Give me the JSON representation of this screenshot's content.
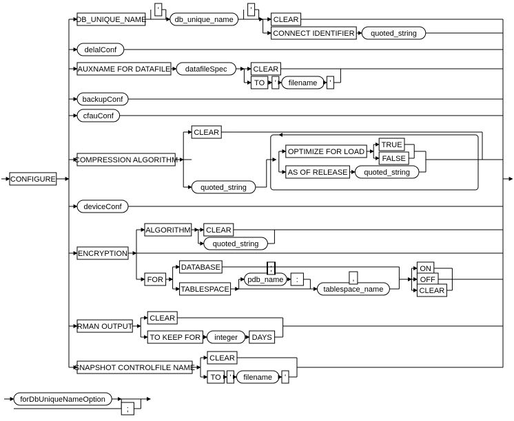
{
  "root": "CONFIGURE",
  "db_unique_name": {
    "kw": "DB_UNIQUE_NAME",
    "nt": "db_unique_name",
    "clear": "CLEAR",
    "conn": "CONNECT IDENTIFIER",
    "qs": "quoted_string"
  },
  "labels": {
    "delalConf": "delalConf",
    "backupConf": "backupConf",
    "cfauConf": "cfauConf",
    "deviceConf": "deviceConf"
  },
  "auxname": {
    "kw": "AUXNAME FOR DATAFILE",
    "spec": "datafileSpec",
    "clear": "CLEAR",
    "to": "TO",
    "fn": "filename"
  },
  "compression": {
    "kw": "COMPRESSION ALGORITHM",
    "clear": "CLEAR",
    "qs": "quoted_string",
    "ofl": "OPTIMIZE FOR LOAD",
    "true": "TRUE",
    "false": "FALSE",
    "asof": "AS OF RELEASE",
    "qs2": "quoted_string"
  },
  "encryption": {
    "kw": "ENCRYPTION",
    "alg": "ALGORITHM",
    "clear": "CLEAR",
    "qs": "quoted_string",
    "for": "FOR",
    "db": "DATABASE",
    "ts": "TABLESPACE",
    "pdb": "pdb_name",
    "colon": ":",
    "tsn": "tablespace_name",
    "on": "ON",
    "off": "OFF",
    "clr": "CLEAR"
  },
  "rman": {
    "kw": "RMAN OUTPUT",
    "clear": "CLEAR",
    "tkf": "TO KEEP FOR",
    "int": "integer",
    "days": "DAYS"
  },
  "snap": {
    "kw": "SNAPSHOT CONTROLFILE NAME",
    "clear": "CLEAR",
    "to": "TO",
    "fn": "filename"
  },
  "tail": {
    "nt": "forDbUniqueNameOption",
    "semi": ";"
  },
  "q": "'",
  "comma": ","
}
